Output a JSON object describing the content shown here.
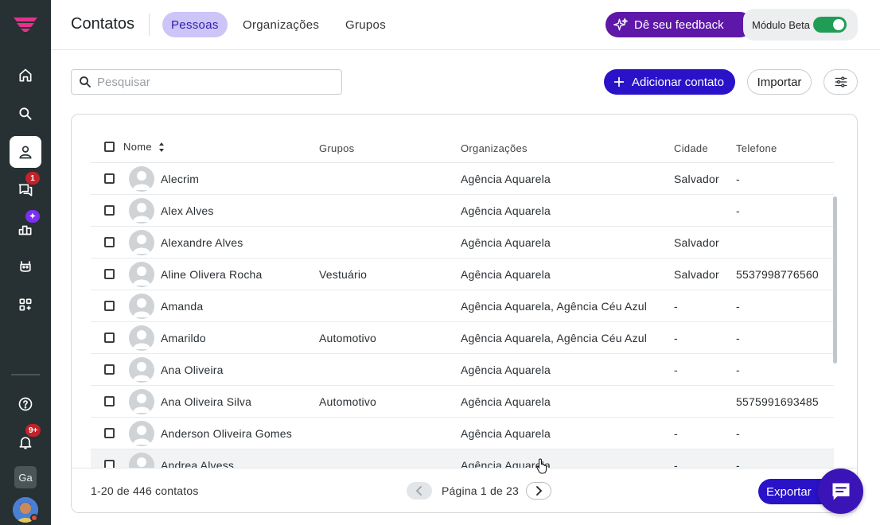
{
  "sidebar": {
    "items": [
      {
        "name": "home",
        "icon": "home-icon",
        "active": false
      },
      {
        "name": "search",
        "icon": "search-icon",
        "active": false
      },
      {
        "name": "contacts",
        "icon": "person-icon",
        "active": true
      },
      {
        "name": "conversations",
        "icon": "chat-icon",
        "badge": "1"
      },
      {
        "name": "reports",
        "icon": "chart-icon",
        "badge": "✦"
      },
      {
        "name": "bot",
        "icon": "bot-icon"
      },
      {
        "name": "apps",
        "icon": "apps-icon"
      }
    ],
    "help_icon": "help-icon",
    "notifications_badge": "9+",
    "workspace_initials": "Ga",
    "colors": {
      "bg": "#273133",
      "badge": "#c0232a",
      "badge_purple": "#7b2ff2"
    }
  },
  "header": {
    "title": "Contatos",
    "tabs": [
      {
        "label": "Pessoas",
        "active": true
      },
      {
        "label": "Organizações",
        "active": false
      },
      {
        "label": "Grupos",
        "active": false
      }
    ],
    "feedback_label": "Dê seu feedback",
    "beta_label": "Módulo Beta",
    "beta_enabled": true
  },
  "toolbar": {
    "search_placeholder": "Pesquisar",
    "search_value": "",
    "add_label": "Adicionar contato",
    "import_label": "Importar",
    "filter_icon": "sliders-icon"
  },
  "table": {
    "columns": [
      "Nome",
      "Grupos",
      "Organizações",
      "Cidade",
      "Telefone"
    ],
    "sort_column": "Nome",
    "rows": [
      {
        "name": "Alecrim",
        "group": "",
        "org": "Agência Aquarela",
        "city": "Salvador",
        "phone": "-"
      },
      {
        "name": "Alex Alves",
        "group": "",
        "org": "Agência Aquarela",
        "city": "",
        "phone": "-"
      },
      {
        "name": "Alexandre Alves",
        "group": "",
        "org": "Agência Aquarela",
        "city": "Salvador",
        "phone": ""
      },
      {
        "name": "Aline Olivera Rocha",
        "group": "Vestuário",
        "org": "Agência Aquarela",
        "city": "Salvador",
        "phone": "5537998776560"
      },
      {
        "name": "Amanda",
        "group": "",
        "org": "Agência Aquarela, Agência Céu Azul",
        "city": "-",
        "phone": "-"
      },
      {
        "name": "Amarildo",
        "group": "Automotivo",
        "org": "Agência Aquarela, Agência Céu Azul",
        "city": "-",
        "phone": "-"
      },
      {
        "name": "Ana Oliveira",
        "group": "",
        "org": "Agência Aquarela",
        "city": "-",
        "phone": "-"
      },
      {
        "name": "Ana Oliveira Silva",
        "group": "Automotivo",
        "org": "Agência Aquarela",
        "city": "",
        "phone": "5575991693485"
      },
      {
        "name": "Anderson Oliveira Gomes",
        "group": "",
        "org": "Agência Aquarela",
        "city": "-",
        "phone": "-"
      },
      {
        "name": "Andrea Alvess",
        "group": "",
        "org": "Agência Aquarela",
        "city": "-",
        "phone": "-"
      }
    ]
  },
  "footer": {
    "count_label": "1-20 de 446 contatos",
    "page_label": "Página 1 de 23",
    "export_label": "Exportar"
  },
  "colors": {
    "primary": "#2a12c9",
    "feedback": "#5e17a8",
    "tab_active_bg": "#cdc4f8",
    "toggle_on": "#1f9d55"
  }
}
